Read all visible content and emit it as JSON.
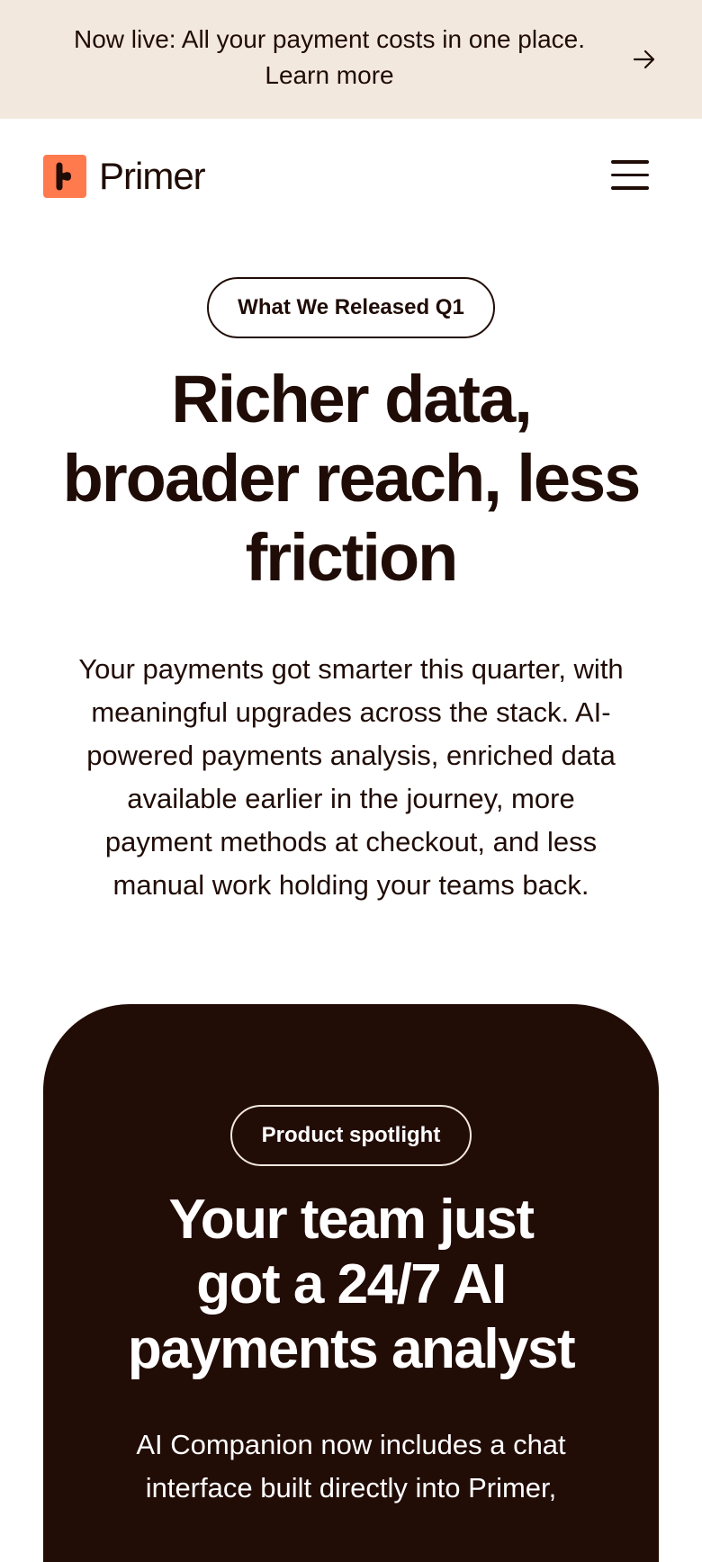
{
  "announcement": {
    "line1": "Now live: All your payment costs in one place.",
    "line2": "Learn more",
    "arrow_icon": "arrow-right-icon"
  },
  "header": {
    "logo_text": "Primer",
    "logo_icon": "primer-logo-icon",
    "menu_icon": "hamburger-menu-icon"
  },
  "hero": {
    "badge": "What We Released Q1",
    "title_lines": [
      "Richer data,",
      "broader reach, less",
      "friction"
    ],
    "description_lines": [
      "Your payments got smarter this quarter, with",
      "meaningful upgrades across the stack. AI-",
      "powered payments analysis, enriched data",
      "available earlier in the journey, more",
      "payment methods at checkout, and less",
      "manual work holding your teams back."
    ]
  },
  "spotlight": {
    "badge": "Product spotlight",
    "title_lines": [
      "Your team just",
      "got a 24/7 AI",
      "payments analyst"
    ],
    "description_lines": [
      "AI Companion now includes a chat",
      "interface built directly into Primer,"
    ]
  },
  "colors": {
    "announcement_bg": "#f3e8de",
    "brand_orange": "#ff7a4d",
    "text_dark": "#200c06",
    "spotlight_bg": "#220c06"
  }
}
